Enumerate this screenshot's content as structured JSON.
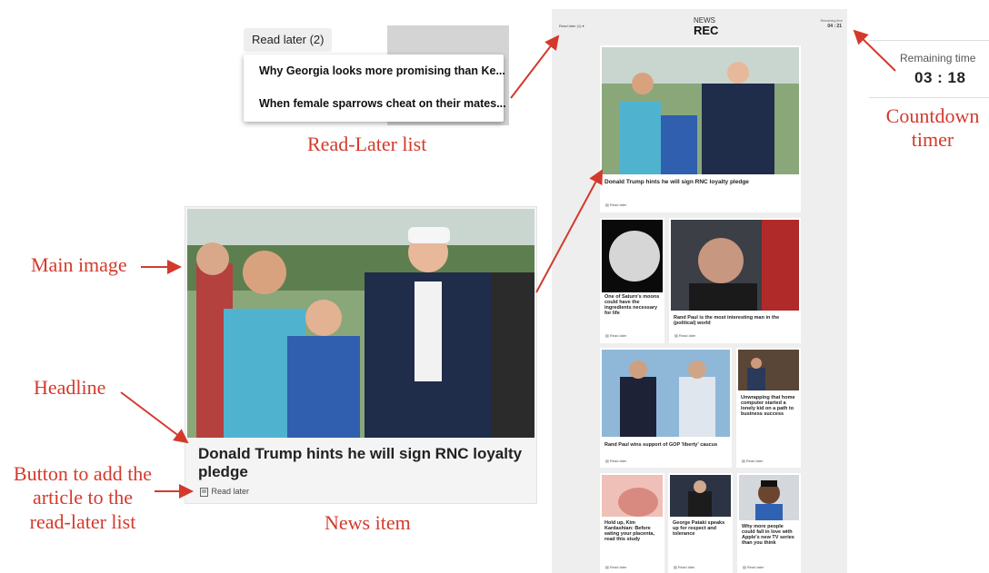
{
  "annotations": {
    "read_later_list": "Read-Later list",
    "countdown_timer_line1": "Countdown",
    "countdown_timer_line2": "timer",
    "main_image": "Main image",
    "headline": "Headline",
    "button_line1": "Button to add the",
    "button_line2": "article to the",
    "button_line3": "read-later list",
    "news_item": "News item"
  },
  "read_later_dropdown": {
    "button_label": "Read later (2) ▲",
    "items": [
      "Why Georgia looks more promising than Ke...",
      "When female sparrows cheat on their mates..."
    ]
  },
  "news_item_example": {
    "headline": "Donald Trump hints he will sign RNC loyalty pledge",
    "read_later_label": "Read later"
  },
  "timer": {
    "label": "Remaining time",
    "value": "03 : 18"
  },
  "app": {
    "read_later_header": "Read later (1) ▾",
    "logo_top": "NEWS",
    "logo_bottom": "REC",
    "remaining_label": "Remaining time",
    "remaining_value": "04 : 21",
    "read_later_label": "Read later",
    "articles": [
      "Donald Trump hints he will sign RNC loyalty pledge",
      "One of Saturn's moons could have the ingredients necessary for life",
      "Rand Paul is the most interesting man in the (political) world",
      "Rand Paul wins support of GOP 'liberty' caucus",
      "Unwrapping that home computer started a lonely kid on a path to business success",
      "Hold up, Kim Kardashian: Before eating your placenta, read this study",
      "George Pataki speaks up for respect and tolerance",
      "Why more people could fall in love with Apple's new TV series than you think"
    ]
  },
  "colors": {
    "annotation": "#d33a2c",
    "app_background": "#eeeeee"
  }
}
